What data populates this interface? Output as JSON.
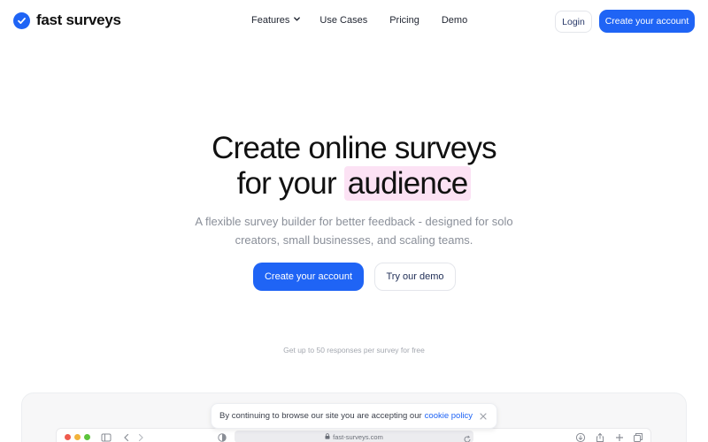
{
  "brand": {
    "name": "fast surveys",
    "logo_icon": "check-circle-icon",
    "color": "#1f64f5"
  },
  "nav": {
    "items": [
      {
        "label": "Features",
        "has_dropdown": true
      },
      {
        "label": "Use Cases"
      },
      {
        "label": "Pricing"
      },
      {
        "label": "Demo"
      }
    ],
    "login_label": "Login",
    "create_account_label": "Create your account"
  },
  "hero": {
    "title_line1": "Create online surveys",
    "title_line2_prefix": "for your",
    "title_highlight": "audience",
    "highlight_color": "#fce2f4",
    "subtitle_line1": "A flexible survey builder for better feedback - designed for solo",
    "subtitle_line2": "creators, small businesses, and scaling teams.",
    "primary_cta": "Create your account",
    "secondary_cta": "Try our demo",
    "free_note": "Get up to 50 responses per survey for free"
  },
  "cookie_banner": {
    "text": "By continuing to browse our site you are accepting our",
    "link_label": "cookie policy"
  },
  "browser_mock": {
    "url": "fast-surveys.com"
  }
}
